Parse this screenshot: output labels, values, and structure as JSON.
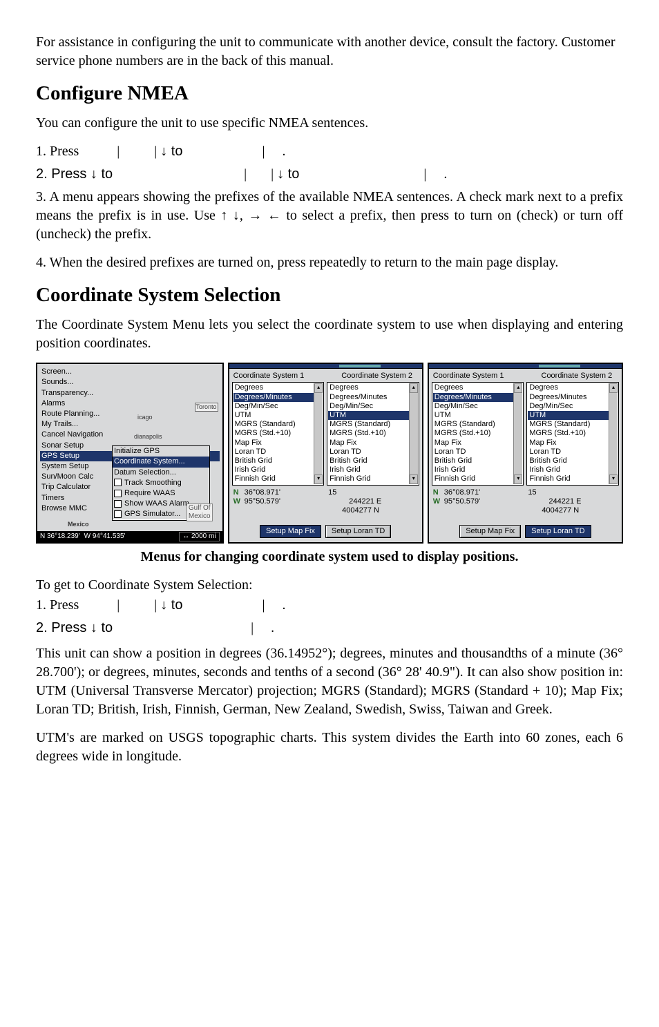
{
  "intro": "For assistance in configuring the unit to communicate with another device, consult the factory. Customer service phone numbers are in the back of this manual.",
  "section1": {
    "title": "Configure NMEA",
    "p1": "You can configure the unit to use specific NMEA sentences.",
    "s1a": "1. Press",
    "s1b": "↓ to",
    "s2a": "2. Press ↓ to",
    "s2b": "↓ to",
    "p3": "3. A menu appears showing the prefixes of the available NMEA sentences. A check mark next to a prefix means the prefix is in use. Use ↑ ↓, → ← to select a prefix, then press         to turn on (check) or turn off (uncheck) the prefix.",
    "p4": "4. When the desired prefixes are turned on, press          repeatedly to return to the main page display."
  },
  "section2": {
    "title": "Coordinate System Selection",
    "p1": "The Coordinate System Menu lets you select the coordinate system to use when displaying and entering position coordinates.",
    "caption": "Menus for changing coordinate system used to display positions.",
    "lead": "To get to Coordinate System Selection:",
    "s1a": "1. Press",
    "s1b": "↓ to",
    "s2a": "2. Press ↓ to",
    "p2": "This unit can show a position in degrees (36.14952°); degrees, minutes and thousandths of a minute (36° 28.700'); or degrees, minutes, seconds and tenths of a second (36° 28' 40.9\"). It can also show position in: UTM (Universal Transverse Mercator) projection; MGRS (Standard); MGRS (Standard + 10); Map Fix; Loran TD; British, Irish, Finnish, German, New Zealand, Swedish, Swiss, Taiwan and Greek.",
    "p3": "UTM's are marked on USGS topographic charts. This system divides the Earth into 60 zones, each 6 degrees wide in longitude."
  },
  "menu": {
    "items": [
      "Screen...",
      "Sounds...",
      "Transparency...",
      "Alarms",
      "Route Planning...",
      "My Trails...",
      "Cancel Navigation",
      "Sonar Setup",
      "GPS Setup",
      "System Setup",
      "Sun/Moon Calc",
      "Trip Calculator",
      "Timers",
      "Browse MMC"
    ],
    "sub": [
      "Initialize GPS",
      "Coordinate System...",
      "Datum Selection...",
      "Track Smoothing",
      "Require WAAS",
      "Show WAAS Alarm",
      "GPS Simulator..."
    ],
    "sel_main": "GPS Setup",
    "sel_sub": "Coordinate System...",
    "map_cities": {
      "toronto": "Toronto",
      "chicago": "icago",
      "indianapolis": "dianapolis",
      "mexico": "Mexico",
      "gulf": "Gulf Of\nMexico"
    },
    "status": {
      "lat": "N   36°18.239'",
      "lon": "W   94°41.535'",
      "scale": "↔ 2000 mi"
    }
  },
  "coord_panel": {
    "h1": "Coordinate System 1",
    "h2": "Coordinate System 2",
    "options": [
      "Degrees",
      "Degrees/Minutes",
      "Deg/Min/Sec",
      "UTM",
      "MGRS (Standard)",
      "MGRS (Std.+10)",
      "Map Fix",
      "Loran TD",
      "British Grid",
      "Irish Grid",
      "Finnish Grid"
    ],
    "sel_left": "Degrees/Minutes",
    "sel_right": "UTM",
    "left": {
      "coords": {
        "n": "N   36°08.971'",
        "w": "W   95°50.579'"
      },
      "utm": {
        "zone": "15",
        "e": "244221 E",
        "n": "4004277 N"
      },
      "btn1": "Setup Map Fix",
      "btn2": "Setup Loran TD",
      "btn_sel": "Setup Map Fix"
    },
    "right": {
      "coords": {
        "n": "N   36°08.971'",
        "w": "W   95°50.579'"
      },
      "utm": {
        "zone": "15",
        "e": "244221 E",
        "n": "4004277 N"
      },
      "btn1": "Setup Map Fix",
      "btn2": "Setup Loran TD",
      "btn_sel": "Setup Loran TD"
    }
  }
}
